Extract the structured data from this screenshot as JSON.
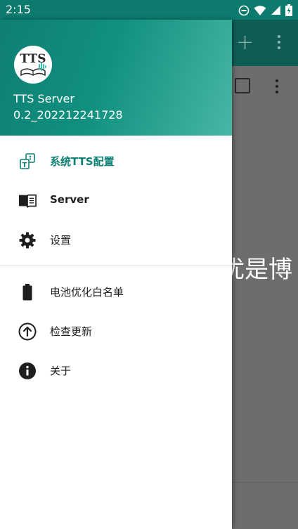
{
  "status_bar": {
    "time": "2:15"
  },
  "background": {
    "overlay_text": "优是博"
  },
  "drawer": {
    "app_name": "TTS Server",
    "app_version": "0.2_202212241728",
    "items": [
      {
        "label": "系统TTS配置",
        "icon": "tts-config-icon",
        "active": true
      },
      {
        "label": "Server",
        "icon": "book-icon"
      },
      {
        "label": "设置",
        "icon": "gear-icon"
      },
      {
        "label": "电池优化白名单",
        "icon": "battery-icon"
      },
      {
        "label": "检查更新",
        "icon": "arrow-up-circle-icon"
      },
      {
        "label": "关于",
        "icon": "info-icon"
      }
    ]
  },
  "colors": {
    "accent": "#0e7f73",
    "status_bar": "#0d7a6e",
    "toolbar": "#0f5e55",
    "scrim": "#6d6d6d"
  }
}
